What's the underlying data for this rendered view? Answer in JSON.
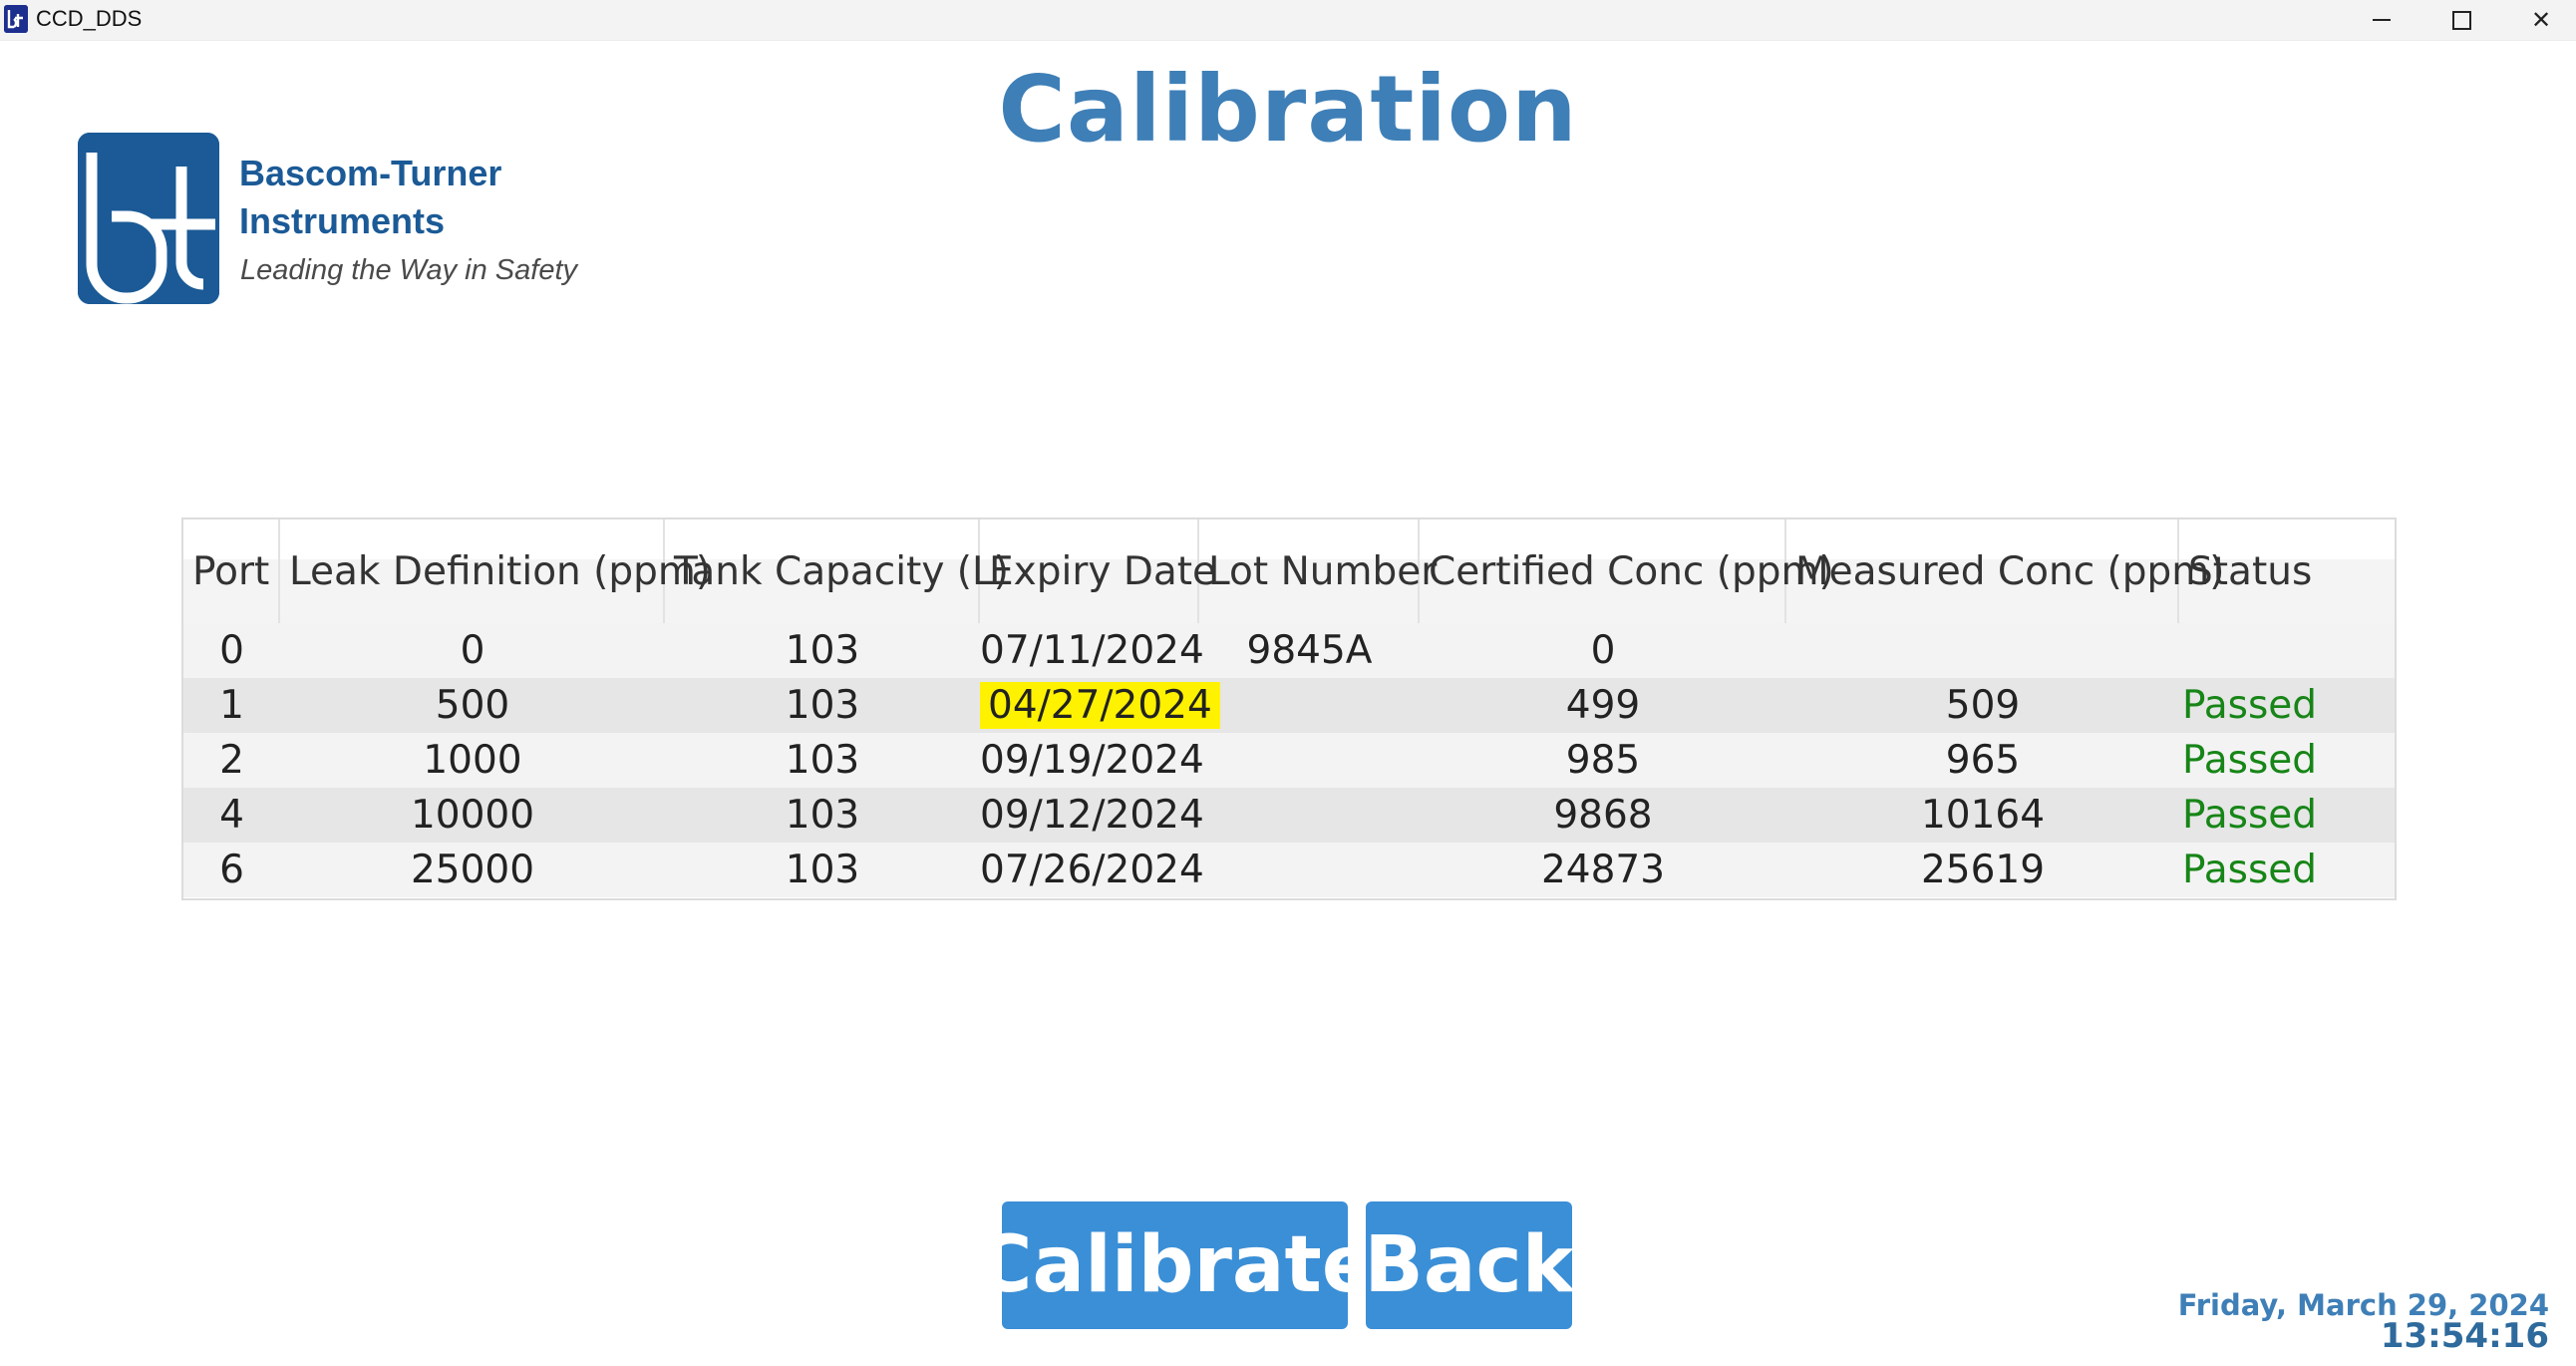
{
  "window": {
    "title": "CCD_DDS",
    "minimize_icon": "minimize-icon",
    "maximize_icon": "maximize-icon",
    "close_icon": "close-icon",
    "close_glyph": "✕"
  },
  "page": {
    "title": "Calibration"
  },
  "logo": {
    "company_line1": "Bascom-Turner",
    "company_line2": "Instruments",
    "tagline": "Leading the Way in Safety",
    "mark_text": "bt",
    "color": "#1b5a96"
  },
  "table": {
    "columns": [
      "Port",
      "Leak Definition (ppm)",
      "Tank Capacity (L)",
      "Expiry Date",
      "Lot Number",
      "Certified Conc (ppm)",
      "Measured Conc (ppm)",
      "Status"
    ],
    "rows": [
      {
        "port": "0",
        "leak": "0",
        "tank": "103",
        "expiry": "07/11/2024",
        "lot": "9845A",
        "certified": "0",
        "measured": "",
        "status": ""
      },
      {
        "port": "1",
        "leak": "500",
        "tank": "103",
        "expiry": "04/27/2024",
        "lot": "",
        "certified": "499",
        "measured": "509",
        "status": "Passed"
      },
      {
        "port": "2",
        "leak": "1000",
        "tank": "103",
        "expiry": "09/19/2024",
        "lot": "",
        "certified": "985",
        "measured": "965",
        "status": "Passed"
      },
      {
        "port": "4",
        "leak": "10000",
        "tank": "103",
        "expiry": "09/12/2024",
        "lot": "",
        "certified": "9868",
        "measured": "10164",
        "status": "Passed"
      },
      {
        "port": "6",
        "leak": "25000",
        "tank": "103",
        "expiry": "07/26/2024",
        "lot": "",
        "certified": "24873",
        "measured": "25619",
        "status": "Passed"
      }
    ],
    "highlight_color": "#fff200",
    "status_color": "#178517"
  },
  "buttons": {
    "calibrate": "Calibrate",
    "back": "Back",
    "color": "#3b8fd6"
  },
  "footer": {
    "date": "Friday, March 29, 2024",
    "time": "13:54:16"
  }
}
